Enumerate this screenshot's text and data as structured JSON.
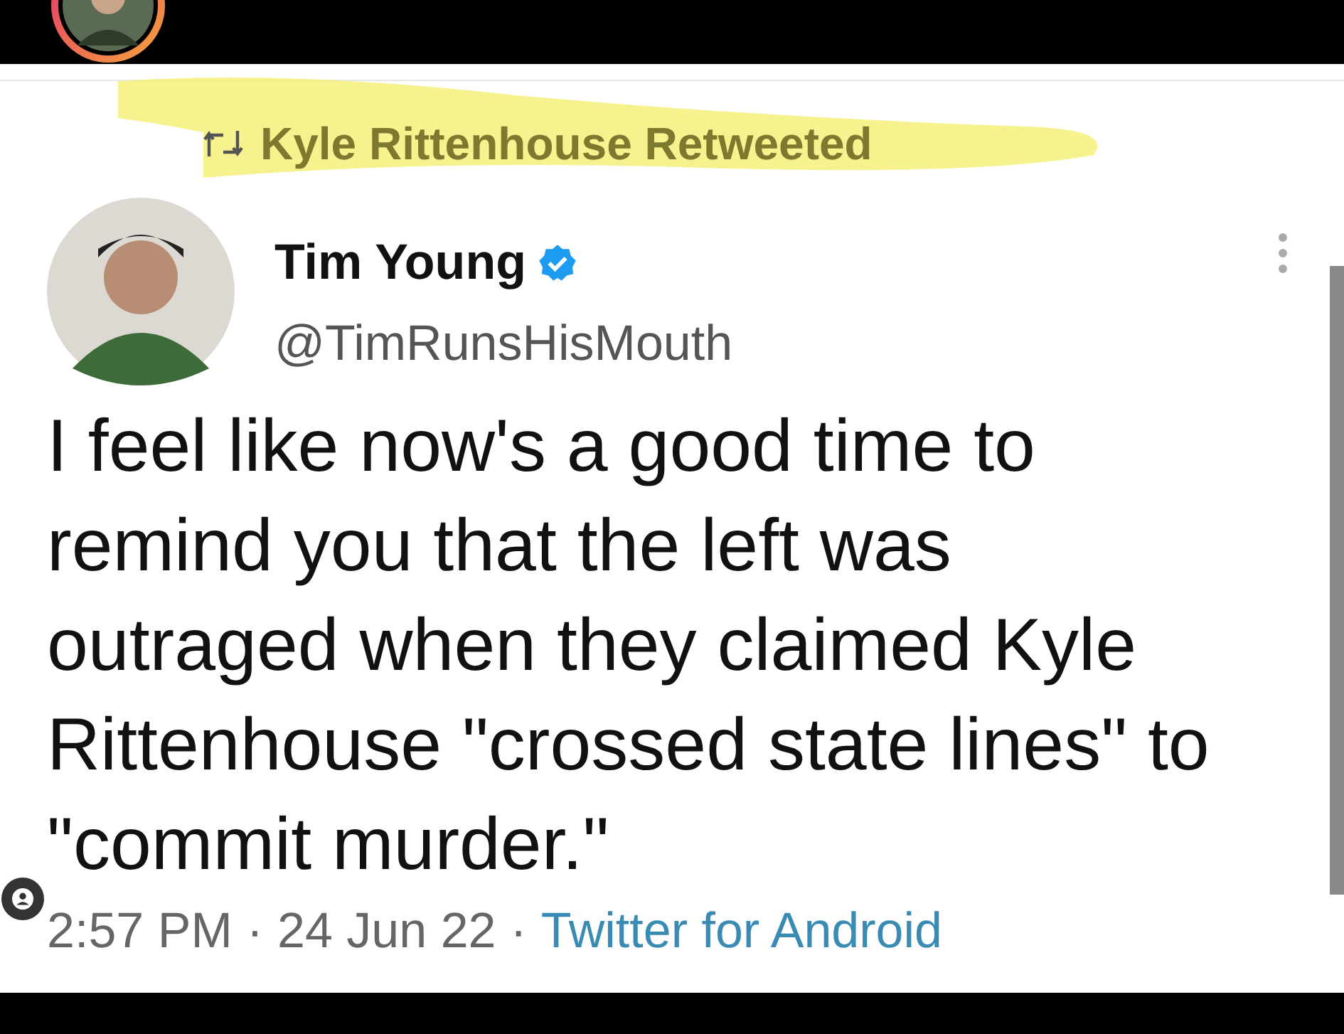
{
  "retweet_label": "Kyle Rittenhouse Retweeted",
  "author": {
    "name": "Tim Young",
    "verified": true,
    "handle": "@TimRunsHisMouth"
  },
  "tweet_text": "I feel like now's a good time to remind you that the left was outraged when they claimed Kyle Rittenhouse \"crossed state lines\" to \"commit murder.\"",
  "meta": [
    {
      "kind": "text",
      "text": "2:57 PM"
    },
    {
      "kind": "separator",
      "text": "·"
    },
    {
      "kind": "text",
      "text": "24 Jun 22"
    },
    {
      "kind": "separator",
      "text": "·"
    },
    {
      "kind": "link",
      "text": "Twitter for Android"
    }
  ]
}
